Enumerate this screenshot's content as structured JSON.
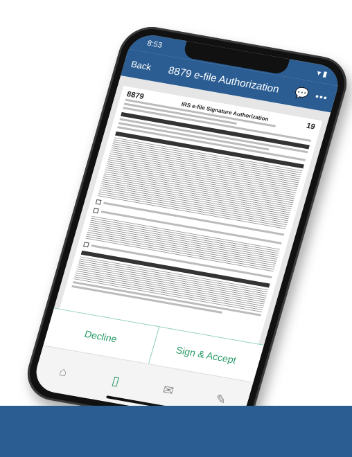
{
  "status": {
    "time": "8:53",
    "icons": "▾ ▮"
  },
  "nav": {
    "back": "Back",
    "title": "8879 e-file Authorization",
    "chat_icon": "chat-icon",
    "more": "•••"
  },
  "document": {
    "form_number": "8879",
    "form_title": "IRS e-file Signature Authorization",
    "tax_year": "19"
  },
  "actions": {
    "decline": "Decline",
    "sign_accept": "Sign & Accept"
  },
  "tabs": [
    {
      "icon": "home-icon",
      "glyph": "⌂"
    },
    {
      "icon": "document-icon",
      "glyph": "▯"
    },
    {
      "icon": "message-icon",
      "glyph": "✉"
    },
    {
      "icon": "signature-icon",
      "glyph": "✎"
    }
  ],
  "colors": {
    "brand": "#2b5d93",
    "accent": "#2a9b68"
  }
}
